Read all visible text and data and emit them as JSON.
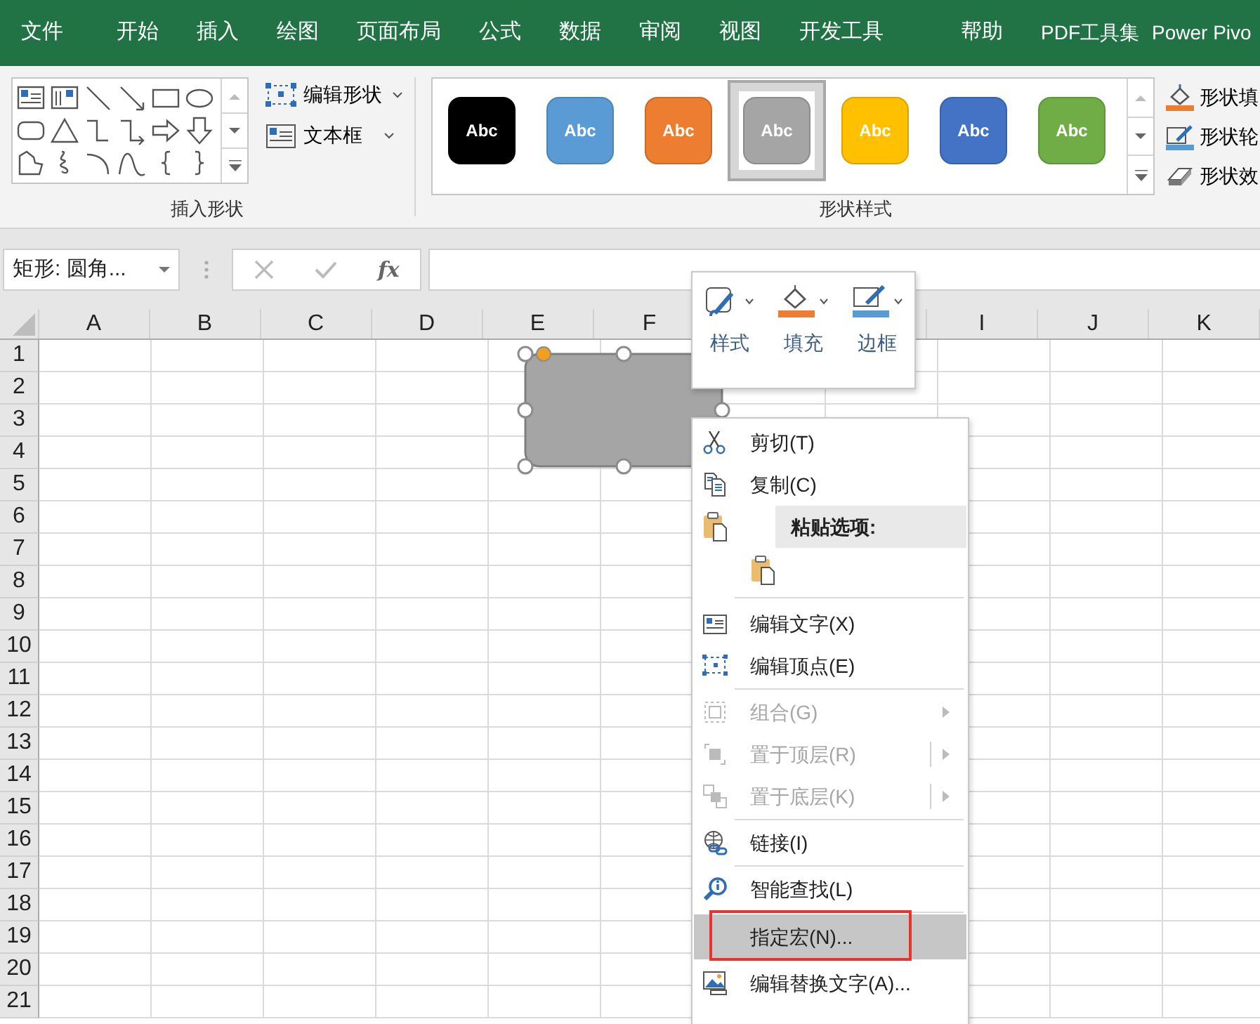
{
  "ribbon_tabs": [
    {
      "label": "文件",
      "selected": false
    },
    {
      "label": "开始",
      "selected": false
    },
    {
      "label": "插入",
      "selected": false
    },
    {
      "label": "绘图",
      "selected": false
    },
    {
      "label": "页面布局",
      "selected": false
    },
    {
      "label": "公式",
      "selected": false
    },
    {
      "label": "数据",
      "selected": false
    },
    {
      "label": "审阅",
      "selected": false
    },
    {
      "label": "视图",
      "selected": false
    },
    {
      "label": "开发工具",
      "selected": false
    },
    {
      "label": "帮助",
      "selected": false
    },
    {
      "label": "PDF工具集",
      "selected": false
    },
    {
      "label": "Power Pivo",
      "selected": false
    }
  ],
  "insert_shapes": {
    "tools": [
      "编辑形状",
      "文本框"
    ],
    "group_label": "插入形状"
  },
  "shape_styles": {
    "swatches": [
      {
        "text": "Abc",
        "color": "#000000",
        "selected": false
      },
      {
        "text": "Abc",
        "color": "#5b9bd5",
        "selected": false
      },
      {
        "text": "Abc",
        "color": "#ed7d31",
        "selected": false
      },
      {
        "text": "Abc",
        "color": "#a5a5a5",
        "selected": true
      },
      {
        "text": "Abc",
        "color": "#ffc000",
        "selected": false
      },
      {
        "text": "Abc",
        "color": "#4472c4",
        "selected": false
      },
      {
        "text": "Abc",
        "color": "#70ad47",
        "selected": false
      }
    ],
    "commands": [
      "形状填",
      "形状轮",
      "形状效"
    ],
    "group_label": "形状样式"
  },
  "formula_bar": {
    "name_box": "矩形: 圆角...",
    "function_label": "fx"
  },
  "sheet": {
    "columns_left": [
      "A",
      "B",
      "C",
      "D",
      "E",
      "F"
    ],
    "columns_right": [
      "I",
      "J",
      "K"
    ],
    "rows": [
      "1",
      "2",
      "3",
      "4",
      "5",
      "6",
      "7",
      "8",
      "9",
      "10",
      "11",
      "12",
      "13",
      "14",
      "15",
      "16",
      "17",
      "18",
      "19",
      "20",
      "21"
    ]
  },
  "mini_toolbar": {
    "buttons": [
      {
        "label": "样式"
      },
      {
        "label": "填充"
      },
      {
        "label": "边框"
      }
    ]
  },
  "context_menu": {
    "items": [
      {
        "kind": "item",
        "label": "剪切(T)",
        "disabled": false,
        "selected": false,
        "submenu": false,
        "split": false,
        "annotated": false
      },
      {
        "kind": "item",
        "label": "复制(C)",
        "disabled": false,
        "selected": false,
        "submenu": false,
        "split": false,
        "annotated": false
      },
      {
        "kind": "header",
        "label": "粘贴选项:"
      },
      {
        "kind": "paste"
      },
      {
        "kind": "separator"
      },
      {
        "kind": "item",
        "label": "编辑文字(X)",
        "disabled": false,
        "selected": false,
        "submenu": false,
        "split": false,
        "annotated": false
      },
      {
        "kind": "item",
        "label": "编辑顶点(E)",
        "disabled": false,
        "selected": false,
        "submenu": false,
        "split": false,
        "annotated": false
      },
      {
        "kind": "separator"
      },
      {
        "kind": "item",
        "label": "组合(G)",
        "disabled": true,
        "selected": false,
        "submenu": true,
        "split": false,
        "annotated": false
      },
      {
        "kind": "item",
        "label": "置于顶层(R)",
        "disabled": true,
        "selected": false,
        "submenu": true,
        "split": true,
        "annotated": false
      },
      {
        "kind": "item",
        "label": "置于底层(K)",
        "disabled": true,
        "selected": false,
        "submenu": true,
        "split": true,
        "annotated": false
      },
      {
        "kind": "separator"
      },
      {
        "kind": "item",
        "label": "链接(I)",
        "disabled": false,
        "selected": false,
        "submenu": false,
        "split": false,
        "annotated": false
      },
      {
        "kind": "separator"
      },
      {
        "kind": "item",
        "label": "智能查找(L)",
        "disabled": false,
        "selected": false,
        "submenu": false,
        "split": false,
        "annotated": false
      },
      {
        "kind": "separator"
      },
      {
        "kind": "item",
        "label": "指定宏(N)...",
        "disabled": false,
        "selected": true,
        "submenu": false,
        "split": false,
        "annotated": true
      },
      {
        "kind": "item",
        "label": "编辑替换文字(A)...",
        "disabled": false,
        "selected": false,
        "submenu": false,
        "split": false,
        "annotated": false
      }
    ]
  }
}
